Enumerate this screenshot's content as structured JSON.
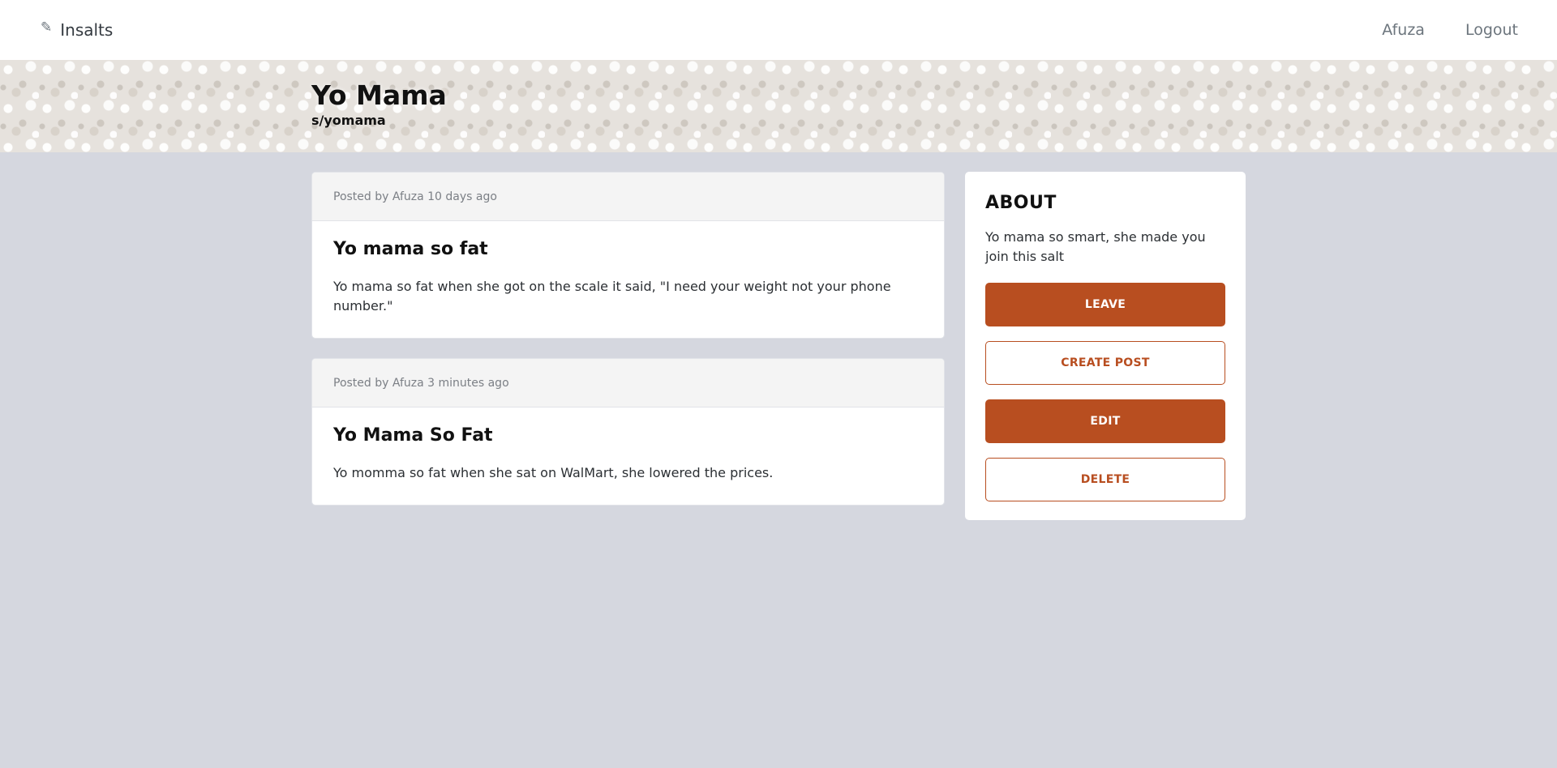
{
  "navbar": {
    "brand_icon": "✎",
    "brand_name": "Insalts",
    "links": [
      {
        "label": "Afuza"
      },
      {
        "label": "Logout"
      }
    ]
  },
  "banner": {
    "title": "Yo Mama",
    "slug": "s/yomama"
  },
  "posts": [
    {
      "meta": "Posted by Afuza 10 days ago",
      "title": "Yo mama so fat",
      "body": "Yo mama so fat when she got on the scale it said, \"I need your weight not your phone number.\""
    },
    {
      "meta": "Posted by Afuza 3 minutes ago",
      "title": "Yo Mama So Fat",
      "body": "Yo momma so fat when she sat on WalMart, she lowered the prices."
    }
  ],
  "about": {
    "heading": "ABOUT",
    "description": "Yo mama so smart, she made you join this salt",
    "buttons": {
      "leave": "LEAVE",
      "create_post": "CREATE POST",
      "edit": "EDIT",
      "delete": "DELETE"
    }
  },
  "colors": {
    "accent": "#b84e20",
    "page_background": "#d5d7df"
  }
}
